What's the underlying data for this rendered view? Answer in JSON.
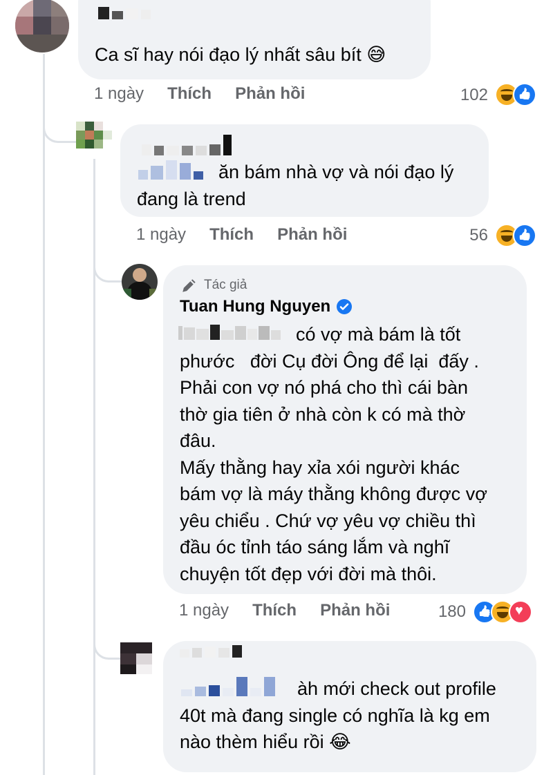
{
  "comments": [
    {
      "text": "Ca sĩ hay nói đạo lý nhất sâu bít 😅",
      "time": "1 ngày",
      "like": "Thích",
      "reply": "Phản hồi",
      "count": "102"
    },
    {
      "text": "ăn bám nhà vợ và nói đạo lý\nđang là trend",
      "time": "1 ngày",
      "like": "Thích",
      "reply": "Phản hồi",
      "count": "56"
    },
    {
      "author_badge": "Tác giả",
      "author_name": "Tuan Hung Nguyen",
      "text": "có vợ mà bám là tốt\nphước   đời Cụ đời Ông để lại  đấy .\nPhải con vợ nó phá cho thì cái bàn\nthờ gia tiên ở nhà còn k có mà thờ\nđâu.\nMấy thằng hay xỉa xói người khác\nbám vợ là máy thằng không được vợ\nyêu chiểu . Chứ vợ yêu vợ chiều thì\nđầu óc tỉnh táo sáng lắm và nghĩ\nchuyện tốt đẹp với đời mà thôi.",
      "time": "1 ngày",
      "like": "Thích",
      "reply": "Phản hồi",
      "count": "180"
    },
    {
      "text": "àh mới check out profile\n40t mà đang single có nghĩa là kg em\nnào thèm hiểu rồi 😂"
    }
  ],
  "icons": {
    "verified": "verified-badge-icon",
    "author": "pencil-icon",
    "reactions": [
      "haha-reaction-icon",
      "like-reaction-icon",
      "love-reaction-icon"
    ]
  },
  "colors": {
    "bubble": "#f0f2f5",
    "meta": "#65676b",
    "like": "#1877f2",
    "haha": "#f7b125",
    "love": "#f33e58"
  }
}
